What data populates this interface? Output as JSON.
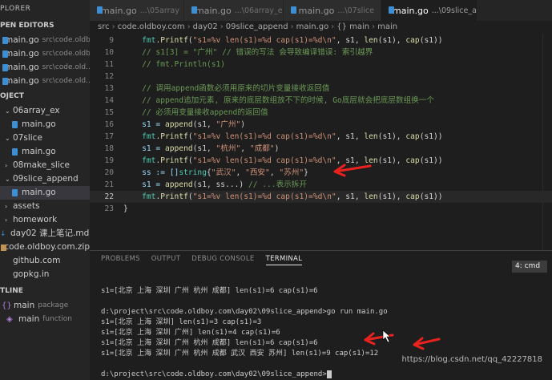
{
  "sidebar": {
    "title": "PLORER",
    "open_editors_label": "PEN EDITORS",
    "open_editors": [
      {
        "name": "main.go",
        "path": "src\\code.oldb..."
      },
      {
        "name": "main.go",
        "path": "src\\code.oldb..."
      },
      {
        "name": "main.go",
        "path": "src\\code.old..."
      },
      {
        "name": "main.go",
        "path": "src\\code.old..."
      }
    ],
    "project_label": "OJECT",
    "tree": [
      {
        "label": "06array_ex",
        "kind": "folder",
        "indent": 6
      },
      {
        "label": "main.go",
        "kind": "go",
        "indent": 14
      },
      {
        "label": "07slice",
        "kind": "folder",
        "indent": 6
      },
      {
        "label": "main.go",
        "kind": "go",
        "indent": 14
      },
      {
        "label": "08make_slice",
        "kind": "folder-collapsed",
        "indent": 6
      },
      {
        "label": "09slice_append",
        "kind": "folder",
        "indent": 6
      },
      {
        "label": "main.go",
        "kind": "go",
        "indent": 14,
        "selected": true
      },
      {
        "label": "assets",
        "kind": "folder-collapsed",
        "indent": 6
      },
      {
        "label": "homework",
        "kind": "folder-collapsed",
        "indent": 6
      },
      {
        "label": "day02 课上笔记.md",
        "kind": "md",
        "indent": 0
      },
      {
        "label": "code.oldboy.com.zip",
        "kind": "zip",
        "indent": 0
      },
      {
        "label": "github.com",
        "kind": "plain",
        "indent": 6
      },
      {
        "label": "gopkg.in",
        "kind": "plain",
        "indent": 6
      }
    ],
    "outline_label": "TLINE",
    "outline": [
      {
        "label": "main",
        "detail": "package",
        "kind": "package"
      },
      {
        "label": "main",
        "detail": "function",
        "kind": "function"
      }
    ]
  },
  "tabs": [
    {
      "name": "main.go",
      "dir": "...\\05array",
      "active": false
    },
    {
      "name": "main.go",
      "dir": "...\\06array_ex",
      "active": false
    },
    {
      "name": "main.go",
      "dir": "...\\07slice",
      "active": false
    },
    {
      "name": "main.go",
      "dir": "...\\09slice_append",
      "active": true
    }
  ],
  "breadcrumb": [
    "src",
    "code.oldboy.com",
    "day02",
    "09slice_append",
    "main.go",
    "{} main",
    "main"
  ],
  "code_lines": [
    {
      "n": "9",
      "tokens": [
        [
          "    ",
          "#d4d4d4"
        ],
        [
          "fmt",
          "#4ec9b0"
        ],
        [
          ".",
          "#d4d4d4"
        ],
        [
          "Printf",
          "#dcdcaa"
        ],
        [
          "(",
          "#d4d4d4"
        ],
        [
          "\"s1=%v len(s1)=%d cap(s1)=%d\\n\"",
          "#ce9178"
        ],
        [
          ", s1, ",
          "#d4d4d4"
        ],
        [
          "len",
          "#dcdcaa"
        ],
        [
          "(s1), ",
          "#d4d4d4"
        ],
        [
          "cap",
          "#dcdcaa"
        ],
        [
          "(s1))",
          "#d4d4d4"
        ]
      ]
    },
    {
      "n": "10",
      "tokens": [
        [
          "    // s1[3] = \"广州\" // 错误的写法 会导致编译错误: 索引越界",
          "#6a9955"
        ]
      ]
    },
    {
      "n": "11",
      "tokens": [
        [
          "    // fmt.Println(s1)",
          "#6a9955"
        ]
      ]
    },
    {
      "n": "12",
      "tokens": []
    },
    {
      "n": "13",
      "tokens": [
        [
          "    // 调用append函数必须用原来的切片变量接收返回值",
          "#6a9955"
        ]
      ]
    },
    {
      "n": "14",
      "tokens": [
        [
          "    // append追加元素, 原来的底层数组放不下的时候, Go底层就会把底层数组换一个",
          "#6a9955"
        ]
      ]
    },
    {
      "n": "15",
      "tokens": [
        [
          "    // 必须用变量接收append的返回值",
          "#6a9955"
        ]
      ]
    },
    {
      "n": "16",
      "tokens": [
        [
          "    s1 = ",
          "#9cdcfe"
        ],
        [
          "append",
          "#dcdcaa"
        ],
        [
          "(s1, ",
          "#d4d4d4"
        ],
        [
          "\"广州\"",
          "#ce9178"
        ],
        [
          ")",
          "#d4d4d4"
        ]
      ]
    },
    {
      "n": "17",
      "tokens": [
        [
          "    ",
          "#d4d4d4"
        ],
        [
          "fmt",
          "#4ec9b0"
        ],
        [
          ".",
          "#d4d4d4"
        ],
        [
          "Printf",
          "#dcdcaa"
        ],
        [
          "(",
          "#d4d4d4"
        ],
        [
          "\"s1=%v len(s1)=%d cap(s1)=%d\\n\"",
          "#ce9178"
        ],
        [
          ", s1, ",
          "#d4d4d4"
        ],
        [
          "len",
          "#dcdcaa"
        ],
        [
          "(s1), ",
          "#d4d4d4"
        ],
        [
          "cap",
          "#dcdcaa"
        ],
        [
          "(s1))",
          "#d4d4d4"
        ]
      ]
    },
    {
      "n": "18",
      "tokens": [
        [
          "    s1 = ",
          "#9cdcfe"
        ],
        [
          "append",
          "#dcdcaa"
        ],
        [
          "(s1, ",
          "#d4d4d4"
        ],
        [
          "\"杭州\"",
          "#ce9178"
        ],
        [
          ", ",
          "#d4d4d4"
        ],
        [
          "\"成都\"",
          "#ce9178"
        ],
        [
          ")",
          "#d4d4d4"
        ]
      ]
    },
    {
      "n": "19",
      "tokens": [
        [
          "    ",
          "#d4d4d4"
        ],
        [
          "fmt",
          "#4ec9b0"
        ],
        [
          ".",
          "#d4d4d4"
        ],
        [
          "Printf",
          "#dcdcaa"
        ],
        [
          "(",
          "#d4d4d4"
        ],
        [
          "\"s1=%v len(s1)=%d cap(s1)=%d\\n\"",
          "#ce9178"
        ],
        [
          ", s1, ",
          "#d4d4d4"
        ],
        [
          "len",
          "#dcdcaa"
        ],
        [
          "(s1), ",
          "#d4d4d4"
        ],
        [
          "cap",
          "#dcdcaa"
        ],
        [
          "(s1))",
          "#d4d4d4"
        ]
      ]
    },
    {
      "n": "20",
      "tokens": [
        [
          "    ss := []",
          "#9cdcfe"
        ],
        [
          "string",
          "#4ec9b0"
        ],
        [
          "{",
          "#d4d4d4"
        ],
        [
          "\"武汉\"",
          "#ce9178"
        ],
        [
          ", ",
          "#d4d4d4"
        ],
        [
          "\"西安\"",
          "#ce9178"
        ],
        [
          ", ",
          "#d4d4d4"
        ],
        [
          "\"苏州\"",
          "#ce9178"
        ],
        [
          "}",
          "#d4d4d4"
        ]
      ]
    },
    {
      "n": "21",
      "tokens": [
        [
          "    s1 = ",
          "#9cdcfe"
        ],
        [
          "append",
          "#dcdcaa"
        ],
        [
          "(s1, ss...) ",
          "#d4d4d4"
        ],
        [
          "// ...表示拆开",
          "#6a9955"
        ]
      ]
    },
    {
      "n": "22",
      "tokens": [
        [
          "    ",
          "#d4d4d4"
        ],
        [
          "fmt",
          "#4ec9b0"
        ],
        [
          ".",
          "#d4d4d4"
        ],
        [
          "Printf",
          "#dcdcaa"
        ],
        [
          "(",
          "#d4d4d4"
        ],
        [
          "\"s1=%v len(s1)=%d cap(s1)=%d\\n\"",
          "#ce9178"
        ],
        [
          ", s1, ",
          "#d4d4d4"
        ],
        [
          "len",
          "#dcdcaa"
        ],
        [
          "(s1), ",
          "#d4d4d4"
        ],
        [
          "cap",
          "#dcdcaa"
        ],
        [
          "(s1))",
          "#d4d4d4"
        ]
      ],
      "current": true
    },
    {
      "n": "23",
      "tokens": [
        [
          "}",
          "#d4d4d4"
        ]
      ]
    }
  ],
  "panel": {
    "tabs": [
      "PROBLEMS",
      "OUTPUT",
      "DEBUG CONSOLE",
      "TERMINAL"
    ],
    "active_tab": "TERMINAL",
    "terminal_select": "4: cmd",
    "terminal_lines": [
      "s1=[北京 上海 深圳 广州 杭州 成都] len(s1)=6 cap(s1)=6",
      "",
      "d:\\project\\src\\code.oldboy.com\\day02\\09slice_append>go run main.go",
      "s1=[北京 上海 深圳] len(s1)=3 cap(s1)=3",
      "s1=[北京 上海 深圳 广州] len(s1)=4 cap(s1)=6",
      "s1=[北京 上海 深圳 广州 杭州 成都] len(s1)=6 cap(s1)=6",
      "s1=[北京 上海 深圳 广州 杭州 成都 武汉 西安 苏州] len(s1)=9 cap(s1)=12",
      "",
      "d:\\project\\src\\code.oldboy.com\\day02\\09slice_append>"
    ],
    "watermark": "https://blog.csdn.net/qq_42227818"
  },
  "colors": {
    "accent": "#007acc",
    "annotation_red": "#e8231f"
  }
}
